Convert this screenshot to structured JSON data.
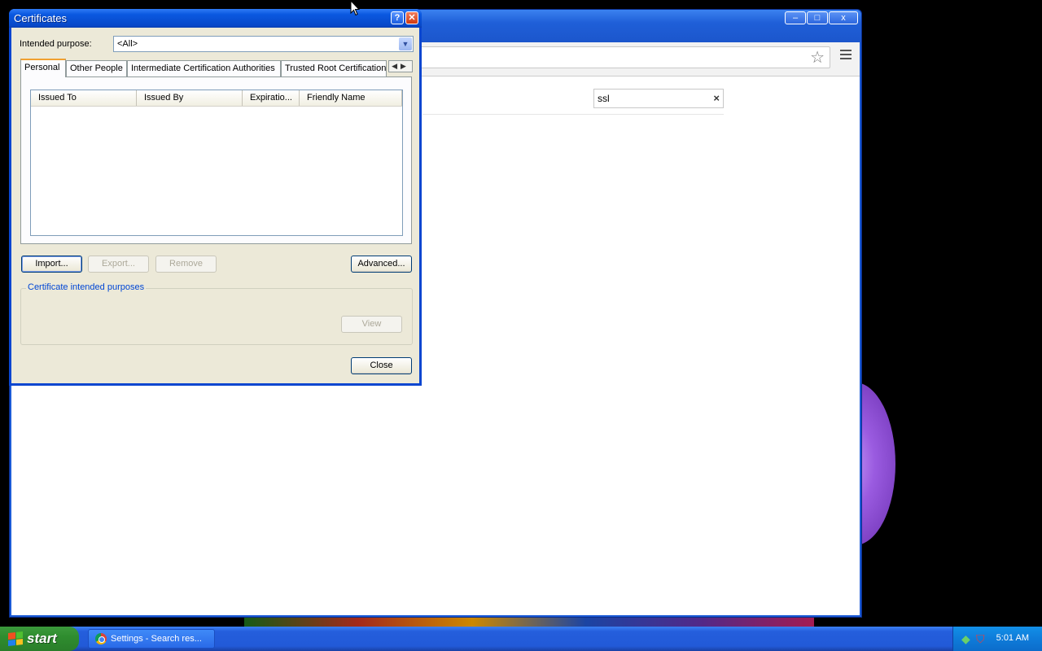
{
  "dialog": {
    "title": "Certificates",
    "help_button": "?",
    "close_button": "✕",
    "intended_purpose_label": "Intended purpose:",
    "intended_purpose_value": "<All>",
    "tabs": [
      {
        "label": "Personal",
        "active": true
      },
      {
        "label": "Other People",
        "active": false
      },
      {
        "label": "Intermediate Certification Authorities",
        "active": false
      },
      {
        "label": "Trusted Root Certification",
        "active": false
      }
    ],
    "columns": [
      "Issued To",
      "Issued By",
      "Expiratio...",
      "Friendly Name"
    ],
    "buttons": {
      "import": "Import...",
      "export": "Export...",
      "remove": "Remove",
      "advanced": "Advanced...",
      "view": "View",
      "close": "Close"
    },
    "purposes_group_label": "Certificate intended purposes"
  },
  "browser": {
    "minimize": "–",
    "maximize": "□",
    "close": "x",
    "settings_search_value": "ssl",
    "settings_search_clear": "×",
    "star_icon": "☆"
  },
  "taskbar": {
    "start_label": "start",
    "task_item_label": "Settings - Search res...",
    "clock": "5:01 AM"
  },
  "colors": {
    "dialog_title_bar": "#0a58e0",
    "dialog_face": "#ece9d8",
    "taskbar": "#245edc",
    "start_button": "#2f8d2f"
  }
}
